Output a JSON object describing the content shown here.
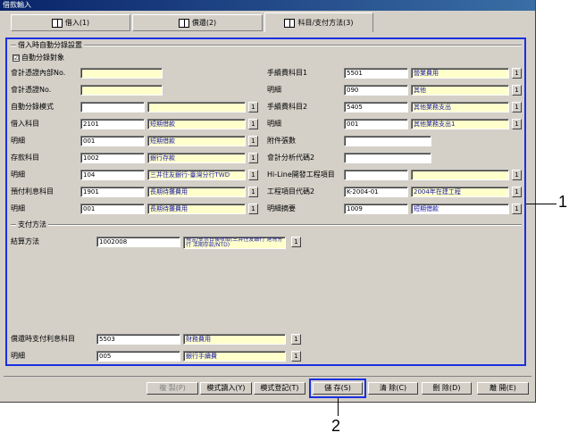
{
  "window": {
    "title": "借款輸入"
  },
  "tabs": [
    {
      "label": "借入(1)"
    },
    {
      "label": "償還(2)"
    },
    {
      "label": "科目/支付方法(3)"
    }
  ],
  "section1": {
    "title": "借入時自動分錄設置",
    "auto_label": "自動分錄對象",
    "checked": "☑",
    "left": [
      {
        "label": "會計憑證內部No.",
        "code": "",
        "name": ""
      },
      {
        "label": "會計憑證No.",
        "code": "",
        "name": ""
      },
      {
        "label": "自動分錄模式",
        "code": "",
        "name": ""
      },
      {
        "label": "借入科目",
        "code": "2101",
        "name": "短期借款"
      },
      {
        "label": "明細",
        "code": "001",
        "name": "短期借款"
      },
      {
        "label": "存款科目",
        "code": "1002",
        "name": "銀行存款"
      },
      {
        "label": "明細",
        "code": "104",
        "name": "三井住友銀行-臺灣分行TWD"
      },
      {
        "label": "預付利息科目",
        "code": "1901",
        "name": "長期待攤費用"
      },
      {
        "label": "明細",
        "code": "001",
        "name": "長期待攤費用"
      }
    ],
    "right": [
      {
        "label": "手續費科目1",
        "code": "5501",
        "name": "營業費用"
      },
      {
        "label": "明細",
        "code": "090",
        "name": "其他"
      },
      {
        "label": "手續費科目2",
        "code": "5405",
        "name": "其他業務支出"
      },
      {
        "label": "明細",
        "code": "001",
        "name": "其他業務支出1"
      },
      {
        "label": "附件張數",
        "code": "",
        "name": ""
      },
      {
        "label": "會計分析代碼2",
        "code": "",
        "name": ""
      },
      {
        "label": "Hi-Line開發工程項目",
        "code": "",
        "name": ""
      },
      {
        "label": "工程項目代碼2",
        "code": "K-2004-01",
        "name": "2004年在建工程"
      },
      {
        "label": "明細摘要",
        "code": "1009",
        "name": "短期借款"
      }
    ]
  },
  "section2": {
    "title": "支付方法",
    "settle_label": "結算方法",
    "settle_code": "1002008",
    "settle_name": "現金/支票日後收取(三井住友銀行 港灣分行 活期存款/NTD)",
    "repay_label": "償還時支付利息科目",
    "repay_code": "5503",
    "repay_name": "財務費用",
    "detail_label": "明細",
    "detail_code": "005",
    "detail_name": "銀行手續費"
  },
  "lookup_glyph": "1",
  "buttons": {
    "copy": "複 製(P)",
    "template_load": "模式讀入(Y)",
    "template_register": "模式登記(T)",
    "save": "儲 存(S)",
    "clear": "清 除(C)",
    "delete": "刪 除(D)",
    "close": "離 開(E)"
  },
  "callouts": {
    "one": "1",
    "two": "2"
  }
}
